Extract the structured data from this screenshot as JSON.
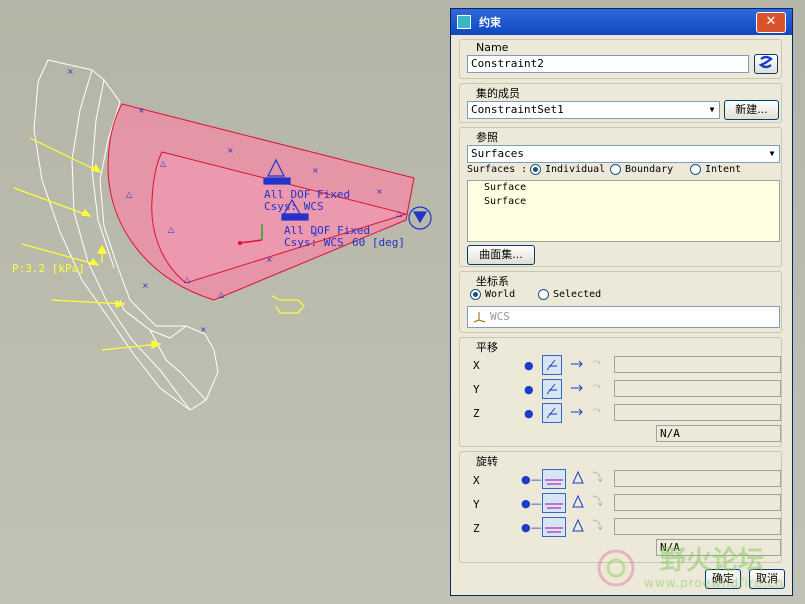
{
  "viewport": {
    "load_label": "P:3.2 [kPa]",
    "constraint1_line1": "All DOF Fixed",
    "constraint1_line2": "Csys: WCS",
    "constraint2_line1": "All DOF Fixed",
    "constraint2_line2": "Csys: WCS",
    "angle_label": "60 [deg]"
  },
  "dialog": {
    "title": "约束",
    "close_glyph": "✕",
    "name_section": {
      "label": "Name",
      "value": "Constraint2"
    },
    "set_section": {
      "label": "集的成员",
      "selected": "ConstraintSet1",
      "new_button": "新建..."
    },
    "ref_section": {
      "label": "参照",
      "selected": "Surfaces",
      "mode_label": "Surfaces :",
      "modes": [
        "Individual",
        "Boundary",
        "Intent"
      ],
      "mode_selected": "Individual",
      "items": [
        "Surface",
        "Surface"
      ],
      "surface_set_button": "曲面集..."
    },
    "csys_section": {
      "label": "坐标系",
      "options": [
        "World",
        "Selected"
      ],
      "option_selected": "World",
      "field_value": "WCS"
    },
    "translation_section": {
      "label": "平移",
      "axes": [
        "X",
        "Y",
        "Z"
      ],
      "na_value": "N/A"
    },
    "rotation_section": {
      "label": "旋转",
      "axes": [
        "X",
        "Y",
        "Z"
      ],
      "na_value": "N/A"
    },
    "ok_button": "确定",
    "cancel_button": "取消"
  },
  "watermark": {
    "text": "野火论坛",
    "url": "www.proewildfire.cn"
  },
  "colors": {
    "surface_fill": "#ec8ea6",
    "constraint_blue": "#2233cc",
    "load_yellow": "#ffff33",
    "title_blue": "#0f47c3"
  }
}
